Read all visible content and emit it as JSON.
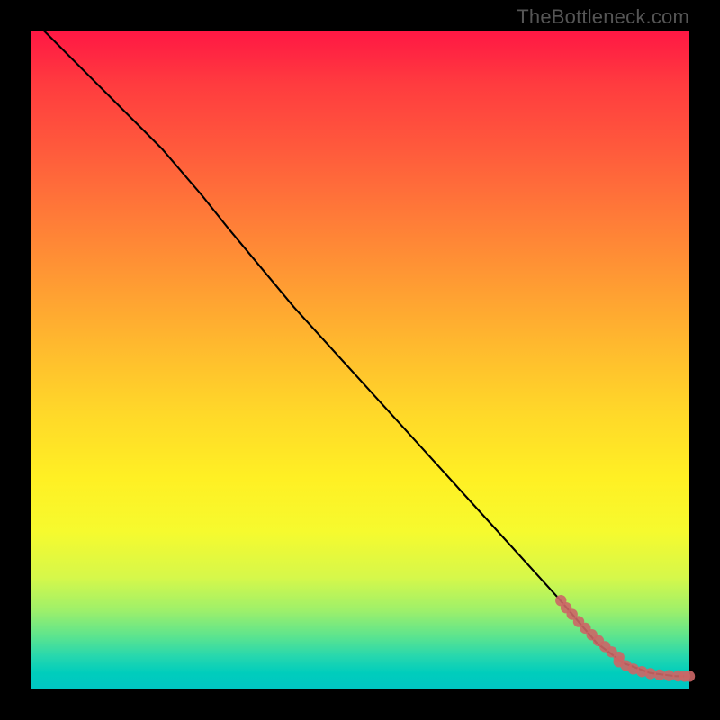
{
  "watermark": "TheBottleneck.com",
  "chart_data": {
    "type": "line",
    "title": "",
    "xlabel": "",
    "ylabel": "",
    "xlim": [
      0,
      100
    ],
    "ylim": [
      0,
      100
    ],
    "grid": false,
    "series": [
      {
        "name": "curve",
        "color": "#000000",
        "x": [
          2,
          10,
          20,
          26,
          30,
          40,
          50,
          60,
          70,
          80,
          86,
          90,
          94,
          98,
          100
        ],
        "y": [
          100,
          92,
          82,
          75,
          70,
          58,
          47,
          36,
          25,
          14,
          7,
          4,
          2.5,
          2,
          2
        ]
      },
      {
        "name": "scatter-points",
        "color": "#cc6666",
        "type": "scatter",
        "x": [
          80.5,
          81.3,
          82.2,
          83.2,
          84.2,
          85.2,
          86.2,
          87.2,
          88.2,
          89.3,
          89.3,
          90.4,
          91.5,
          92.8,
          94.1,
          95.5,
          96.9,
          98.3,
          99.3,
          100
        ],
        "y": [
          13.5,
          12.4,
          11.4,
          10.3,
          9.3,
          8.3,
          7.4,
          6.5,
          5.7,
          4.9,
          4.2,
          3.6,
          3.1,
          2.7,
          2.4,
          2.2,
          2.1,
          2.05,
          2.0,
          2.0
        ]
      }
    ],
    "background_gradient": {
      "top": "#ff1744",
      "bottom": "#00c6c4"
    }
  }
}
